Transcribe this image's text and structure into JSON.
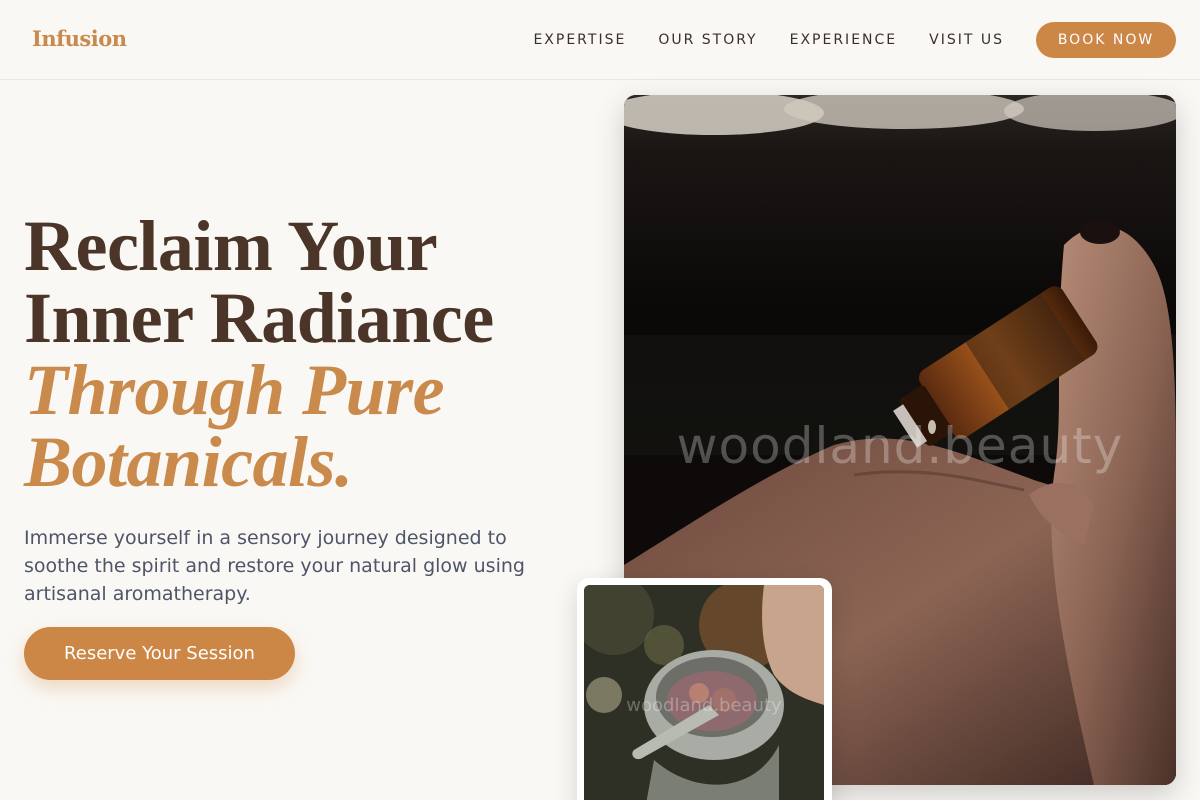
{
  "brand": {
    "logo": "Infusion",
    "accent_color": "#cc8645"
  },
  "nav": {
    "items": [
      "EXPERTISE",
      "OUR STORY",
      "EXPERIENCE",
      "VISIT US"
    ],
    "cta": "BOOK NOW"
  },
  "hero": {
    "title_line1": "Reclaim Your",
    "title_line2": "Inner Radiance",
    "title_accent1": "Through Pure",
    "title_accent2": "Botanicals.",
    "subtitle": "Immerse yourself in a sensory journey designed to soothe the spirit and restore your natural glow using artisanal aromatherapy.",
    "cta": "Reserve Your Session"
  },
  "images": {
    "main_alt": "Hand pouring essential oil drop from amber bottle",
    "main_watermark": "woodland.beauty",
    "secondary_alt": "Mortar and pestle with botanicals",
    "secondary_watermark": "woodland.beauty"
  }
}
